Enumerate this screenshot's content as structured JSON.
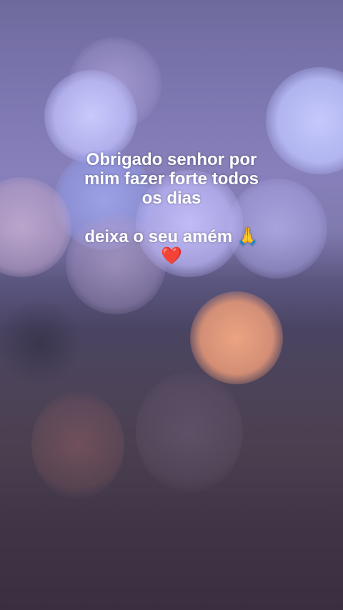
{
  "caption": {
    "line1": "Obrigado senhor por",
    "line2": "mim fazer forte todos",
    "line3": "os dias",
    "line4": "deixa o seu amém",
    "pray_emoji": "🙏",
    "heart_emoji": "❤️"
  },
  "colors": {
    "background_top": "#7a74ad",
    "background_bottom": "#392f40",
    "orange_bokeh": "#e8a07e",
    "heart": "#e8262b",
    "text": "#ffffff"
  }
}
